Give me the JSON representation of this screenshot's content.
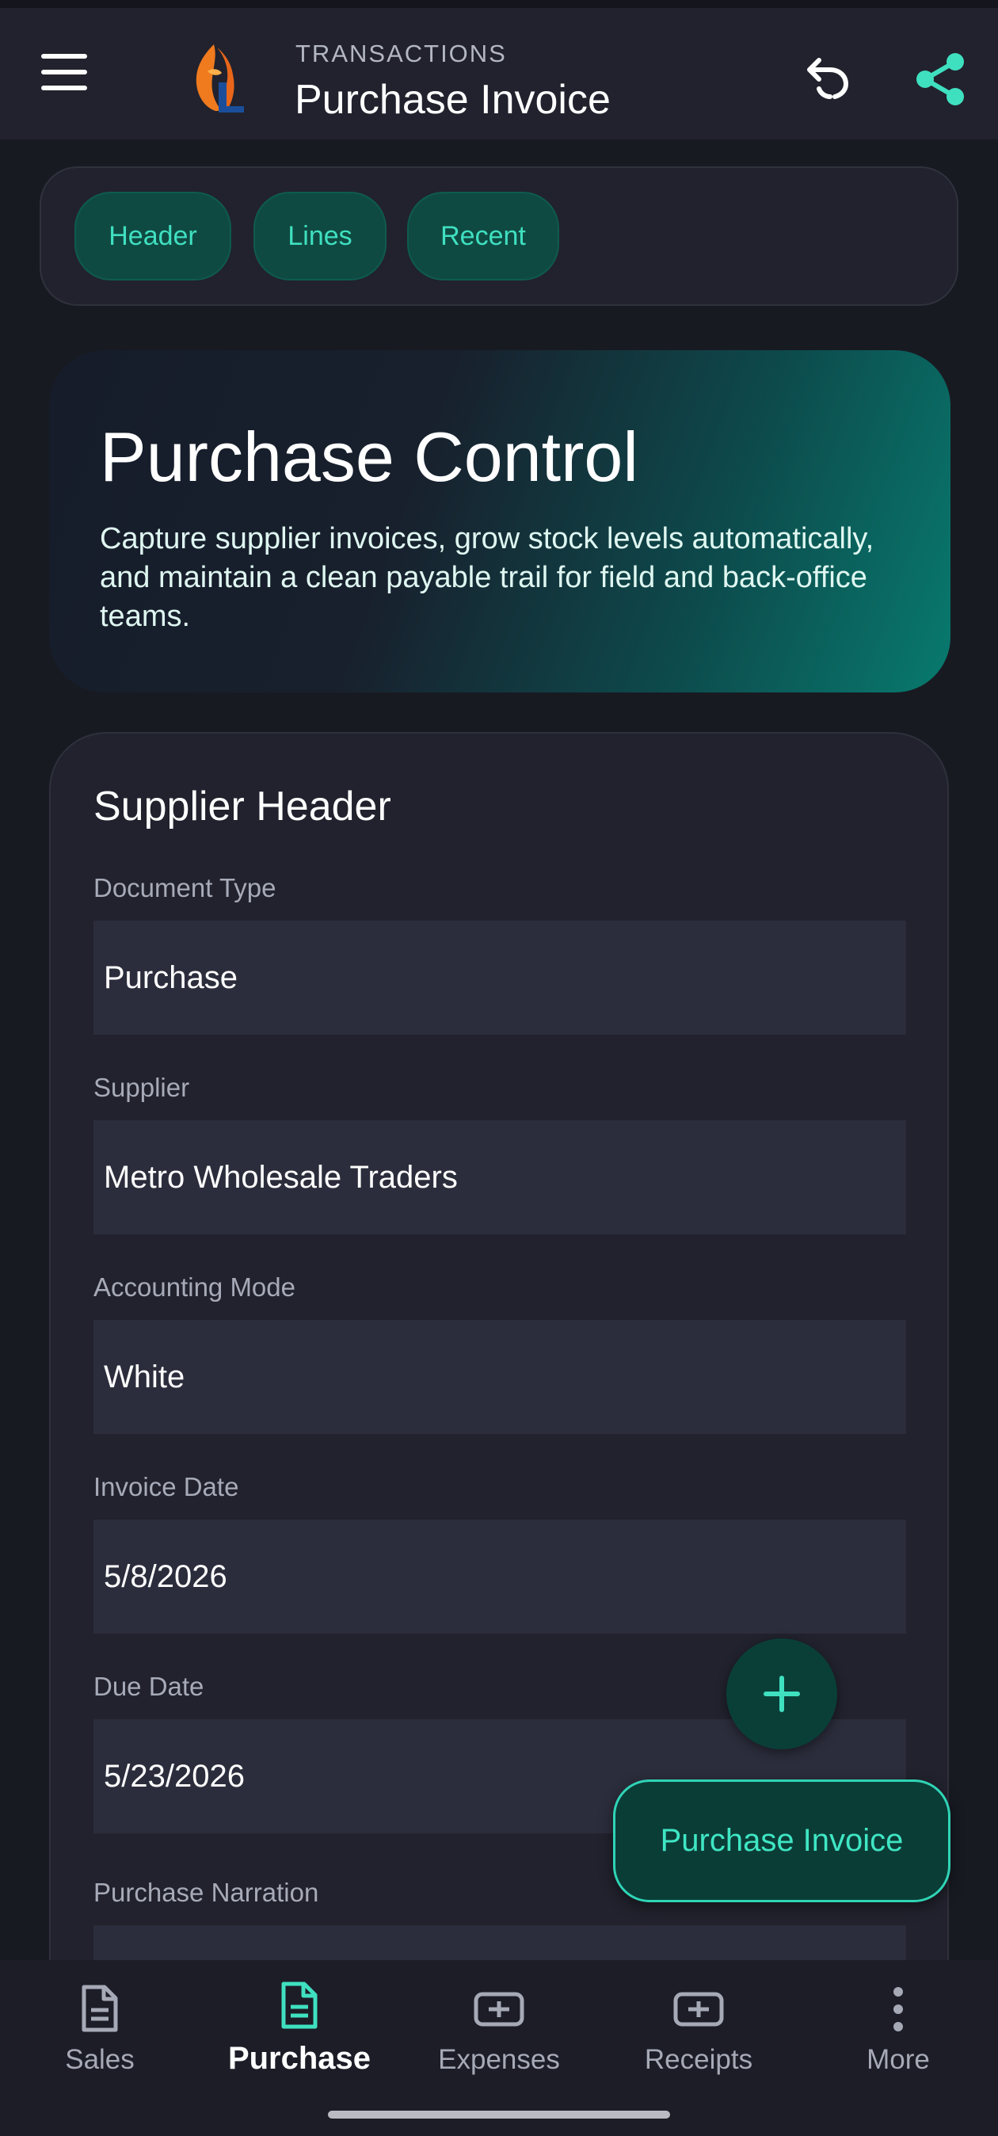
{
  "appbar": {
    "eyebrow": "TRANSACTIONS",
    "title": "Purchase Invoice",
    "icons": {
      "menu": "hamburger-menu-icon",
      "undo": "undo-arrow-icon",
      "share": "share-icon",
      "logo": "conch-shell-logo"
    }
  },
  "chips": [
    {
      "label": "Header"
    },
    {
      "label": "Lines"
    },
    {
      "label": "Recent"
    }
  ],
  "hero": {
    "title": "Purchase Control",
    "description": "Capture supplier invoices, grow stock levels automatically, and maintain a clean payable trail for field and back-office teams."
  },
  "form": {
    "title": "Supplier Header",
    "fields": [
      {
        "label": "Document Type",
        "value": "Purchase"
      },
      {
        "label": "Supplier",
        "value": "Metro Wholesale Traders"
      },
      {
        "label": "Accounting Mode",
        "value": "White"
      },
      {
        "label": "Invoice Date",
        "value": "5/8/2026"
      },
      {
        "label": "Due Date",
        "value": "5/23/2026"
      },
      {
        "label": "Purchase Narration",
        "value": ""
      }
    ]
  },
  "fab": {
    "add_icon": "plus-icon",
    "extended_label": "Purchase Invoice"
  },
  "bottom_nav": [
    {
      "label": "Sales",
      "icon": "document-icon",
      "active": false
    },
    {
      "label": "Purchase",
      "icon": "document-icon",
      "active": true
    },
    {
      "label": "Expenses",
      "icon": "plus-box-icon",
      "active": false
    },
    {
      "label": "Receipts",
      "icon": "plus-box-icon",
      "active": false
    },
    {
      "label": "More",
      "icon": "more-vertical-icon",
      "active": false
    }
  ],
  "colors": {
    "accent": "#3fe0c0",
    "background": "#181a22",
    "surface": "#21222d",
    "input": "#2c2d3c",
    "muted_text": "#a7aab8"
  }
}
